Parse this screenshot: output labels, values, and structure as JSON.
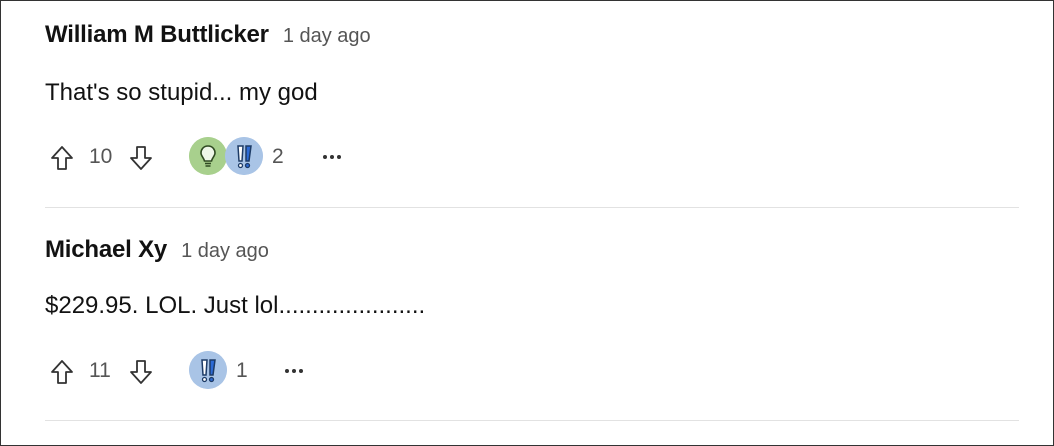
{
  "comments": [
    {
      "author": "William M Buttlicker",
      "timestamp": "1 day ago",
      "text": "That's so stupid... my god",
      "upvotes": "10",
      "reactions": [
        "idea-icon",
        "exclamation-icon"
      ],
      "reaction_count": "2"
    },
    {
      "author": "Michael Xy",
      "timestamp": "1 day ago",
      "text": "$229.95. LOL. Just lol......................",
      "upvotes": "11",
      "reactions": [
        "exclamation-icon"
      ],
      "reaction_count": "1"
    }
  ],
  "colors": {
    "idea_reaction": "#a8d08d",
    "wow_reaction": "#a9c4e6",
    "divider": "#e2e2e2",
    "muted_text": "#555555"
  }
}
